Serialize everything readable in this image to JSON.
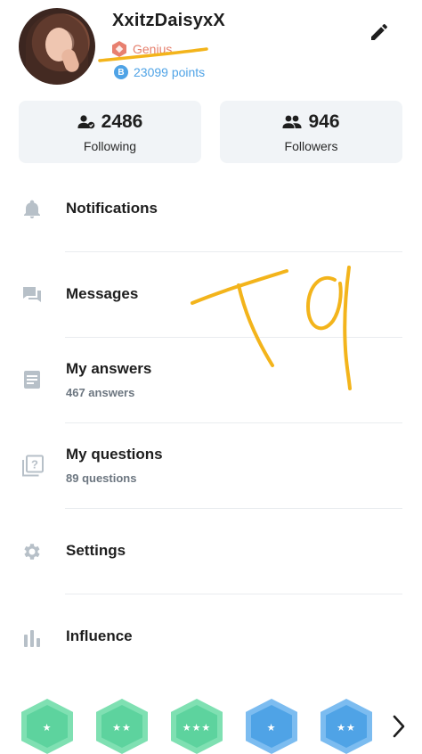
{
  "profile": {
    "username": "XxitzDaisyxX",
    "rank": "Genius",
    "points": "23099 points",
    "points_icon_letter": "B"
  },
  "stats": {
    "following": {
      "count": "2486",
      "label": "Following"
    },
    "followers": {
      "count": "946",
      "label": "Followers"
    }
  },
  "menu": {
    "notifications": "Notifications",
    "messages": "Messages",
    "answers": {
      "title": "My answers",
      "subtitle": "467 answers"
    },
    "questions": {
      "title": "My questions",
      "subtitle": "89 questions"
    },
    "settings": "Settings",
    "influence": "Influence"
  },
  "badges": [
    {
      "name": "badge-1",
      "stars": "★",
      "color": "#5dd39e"
    },
    {
      "name": "badge-2",
      "stars": "★★",
      "color": "#5dd39e"
    },
    {
      "name": "badge-3",
      "stars": "★★★",
      "color": "#5dd39e"
    },
    {
      "name": "badge-4",
      "stars": "★",
      "color": "#4fa3e6"
    },
    {
      "name": "badge-5",
      "stars": "★★",
      "color": "#4fa3e6"
    }
  ],
  "colors": {
    "rank": "#e57f6c",
    "points": "#4fa3e6",
    "scribble": "#f3b41b",
    "icon_gray": "#b7c0c8"
  }
}
